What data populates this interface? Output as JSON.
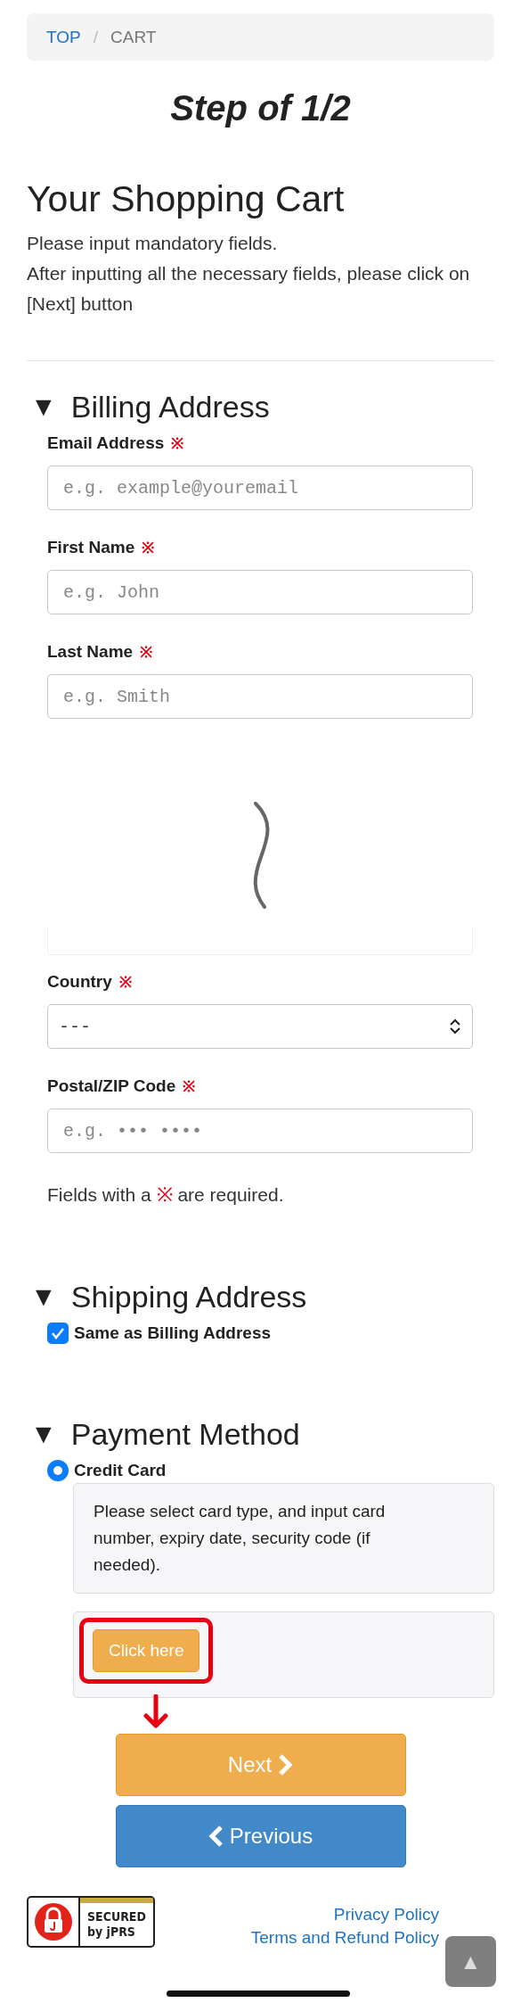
{
  "breadcrumb": [
    {
      "label": "TOP",
      "kind": "link"
    },
    {
      "label": "/",
      "kind": "separator"
    },
    {
      "label": "CART",
      "kind": "current"
    }
  ],
  "step_title": "Step of 1/2",
  "page_title": "Your Shopping Cart",
  "intro": [
    "Please input mandatory fields.",
    "After inputting all the necessary fields, please click on [Next] button"
  ],
  "billing": {
    "marker": "▼",
    "title": "Billing Address",
    "fields": [
      {
        "kind": "text",
        "label": "Email Address",
        "required_mark": "※",
        "placeholder": "e.g. example@youremail"
      },
      {
        "kind": "text",
        "label": "First Name",
        "required_mark": "※",
        "placeholder": "e.g. John"
      },
      {
        "kind": "text",
        "label": "Last Name",
        "required_mark": "※",
        "placeholder": "e.g. Smith"
      },
      {
        "kind": "break"
      },
      {
        "kind": "select",
        "label": "Country",
        "required_mark": "※",
        "value": "---"
      },
      {
        "kind": "text",
        "label": "Postal/ZIP Code",
        "required_mark": "※",
        "placeholder": "e.g. ••• ••••"
      }
    ],
    "note": {
      "before": "Fields with a",
      "mark": "※",
      "after": "are required."
    }
  },
  "shipping": {
    "marker": "▼",
    "title": "Shipping Address",
    "checkbox": {
      "label": "Same as Billing Address",
      "checked": true
    }
  },
  "payment": {
    "marker": "▼",
    "title": "Payment Method",
    "options": [
      {
        "label": "Credit Card",
        "selected": true,
        "description": "Please select card type, and input card number, expiry date, security code (if needed).",
        "action": "Click here"
      }
    ]
  },
  "buttons": [
    {
      "kind": "next",
      "label": "Next"
    },
    {
      "kind": "previous",
      "label": "Previous"
    }
  ],
  "footer": {
    "seal": {
      "line1": "SECURED",
      "line2": "by jPRS"
    },
    "links": [
      "Privacy Policy",
      "Terms and Refund Policy"
    ],
    "scroll_top": "▲"
  }
}
